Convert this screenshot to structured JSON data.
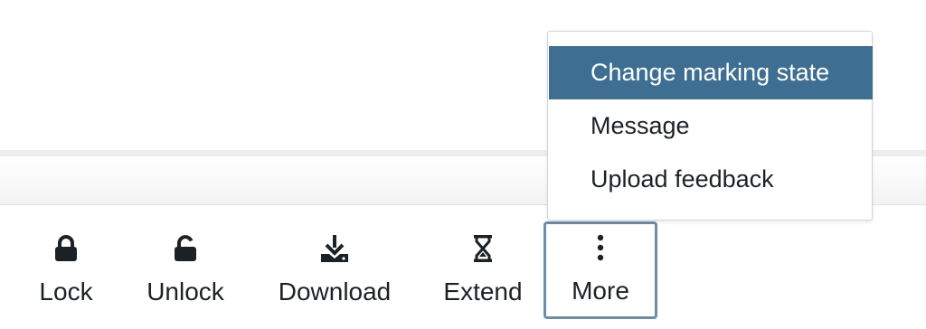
{
  "toolbar": {
    "actions": [
      {
        "label": "Lock",
        "icon": "lock-icon"
      },
      {
        "label": "Unlock",
        "icon": "unlock-icon"
      },
      {
        "label": "Download",
        "icon": "download-icon"
      },
      {
        "label": "Extend",
        "icon": "hourglass-icon"
      },
      {
        "label": "More",
        "icon": "vertical-ellipsis-icon"
      }
    ]
  },
  "more_menu": {
    "items": [
      {
        "label": "Change marking state",
        "active": true
      },
      {
        "label": "Message",
        "active": false
      },
      {
        "label": "Upload feedback",
        "active": false
      }
    ]
  },
  "colors": {
    "accent": "#3e6f93",
    "focus_border": "#6b8fa8",
    "text": "#1d2125"
  }
}
